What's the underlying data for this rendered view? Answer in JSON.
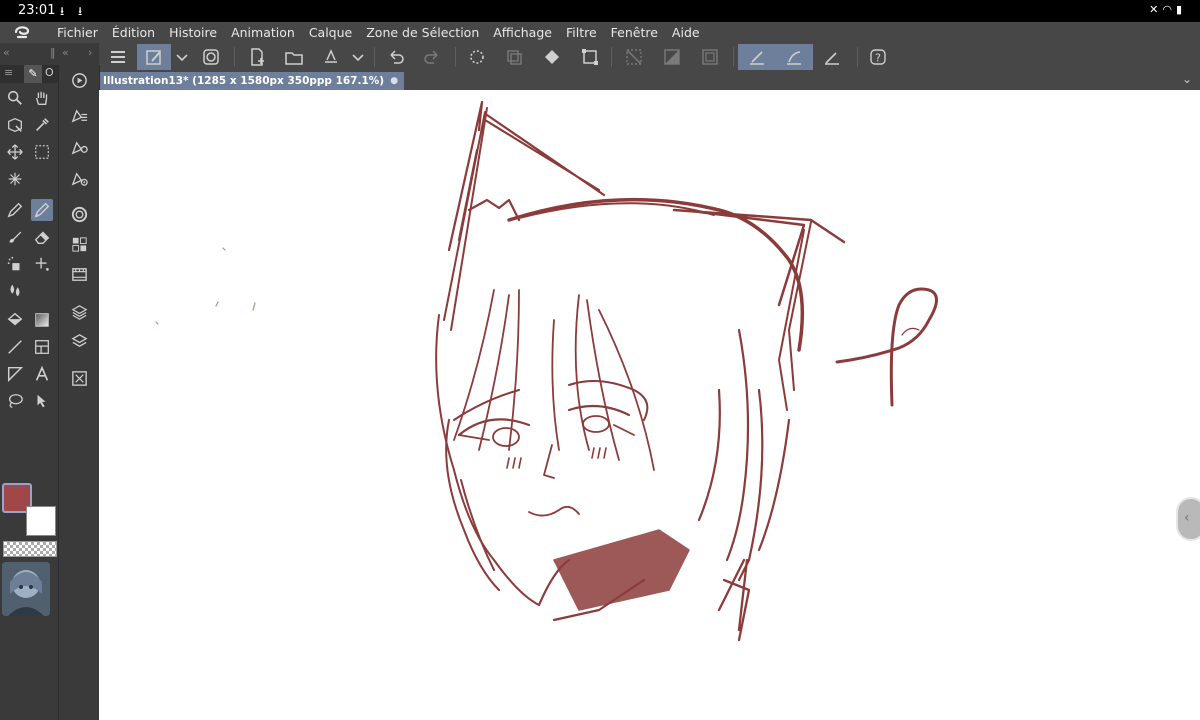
{
  "status_bar": {
    "time": "23:01",
    "download_icons": [
      "download-icon",
      "download-icon"
    ],
    "system_icons": [
      "mute-icon",
      "wifi-icon",
      "battery-icon"
    ]
  },
  "menu": {
    "items": [
      "Fichier",
      "Édition",
      "Histoire",
      "Animation",
      "Calque",
      "Zone de Sélection",
      "Affichage",
      "Filtre",
      "Fenêtre",
      "Aide"
    ]
  },
  "document_tab": {
    "title": "Illustration13* (1285 x 1580px 350ppp 167.1%)"
  },
  "tool_panel_header": {
    "tab_label": "O"
  },
  "colors": {
    "main": "#a04848",
    "sub": "#ffffff",
    "sketch": "#8c3b3b",
    "accent": "#6e7f9c"
  },
  "command_bar": {
    "buttons": [
      "menu-icon",
      "new-canvas-icon",
      "chevron-down-icon",
      "ribbon-icon",
      "new-file-icon",
      "open-folder-icon",
      "save-icon",
      "chevron-down-icon",
      "undo-icon",
      "redo-icon",
      "loading-icon",
      "copy-icon",
      "fill-icon",
      "transform-icon",
      "deselect-icon",
      "invert-selection-icon",
      "crop-icon",
      "snap-ruler-icon",
      "snap-special-ruler-icon",
      "snap-grid-icon",
      "help-icon"
    ]
  },
  "tools": [
    "magnifier-icon",
    "hand-icon",
    "operation-icon",
    "eyedropper-icon",
    "move-icon",
    "marquee-icon",
    "magic-wand-icon",
    "pen-icon",
    "pencil-icon",
    "brush-icon",
    "eraser-icon",
    "airbrush-icon",
    "decoration-icon",
    "blend-icon",
    "fill-icon",
    "gradient-icon",
    "line-icon",
    "frame-icon",
    "ruler-icon",
    "text-icon",
    "lasso-icon",
    "correct-line-icon"
  ],
  "sub_tools": [
    "navigator-icon",
    "layer-property-icon",
    "tool-property-icon",
    "brush-size-icon",
    "color-wheel-icon",
    "color-set-icon",
    "timeline-icon",
    "material-icon",
    "layers-icon",
    "layer-search-icon"
  ]
}
